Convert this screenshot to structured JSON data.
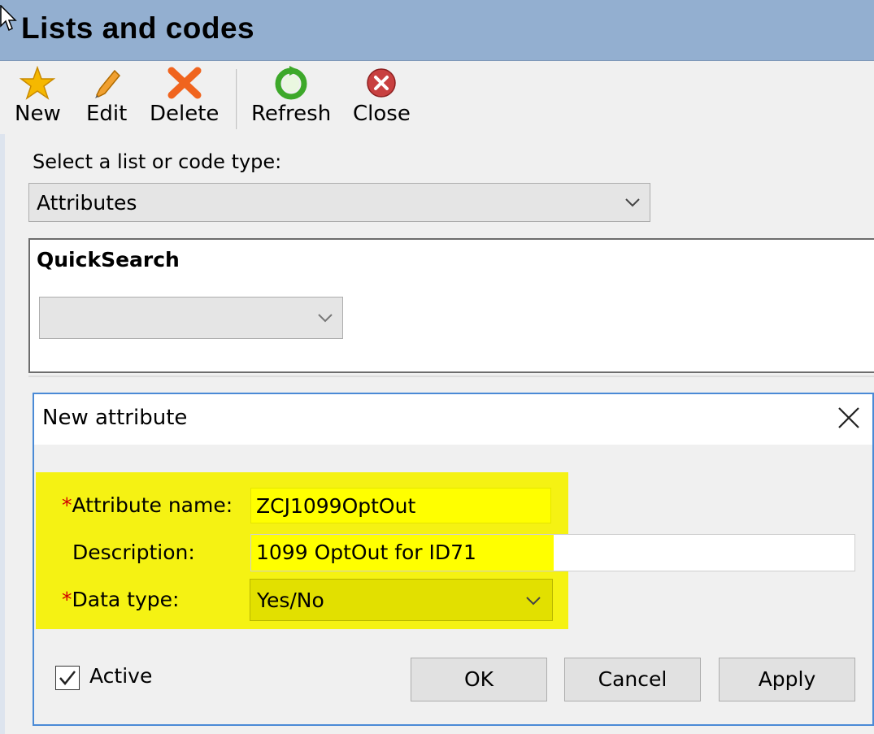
{
  "window": {
    "title": "Lists and codes"
  },
  "toolbar": {
    "new_label": "New",
    "edit_label": "Edit",
    "delete_label": "Delete",
    "refresh_label": "Refresh",
    "close_label": "Close"
  },
  "selector": {
    "label": "Select a list or code type:",
    "value": "Attributes"
  },
  "quicksearch": {
    "title": "QuickSearch",
    "value": ""
  },
  "dialog": {
    "title": "New attribute",
    "required_mark": "*",
    "attribute_name_label": "Attribute name:",
    "attribute_name_value": "ZCJ1099OptOut",
    "description_label": "Description:",
    "description_value": "1099 OptOut for ID71",
    "data_type_label": "Data type:",
    "data_type_value": "Yes/No",
    "active_label": "Active",
    "active_checked": true,
    "ok_label": "OK",
    "cancel_label": "Cancel",
    "apply_label": "Apply"
  },
  "colors": {
    "titlebar": "#93afd0",
    "highlight": "#f5f200",
    "dialog_border": "#4a8ad6",
    "required": "#d00000"
  }
}
